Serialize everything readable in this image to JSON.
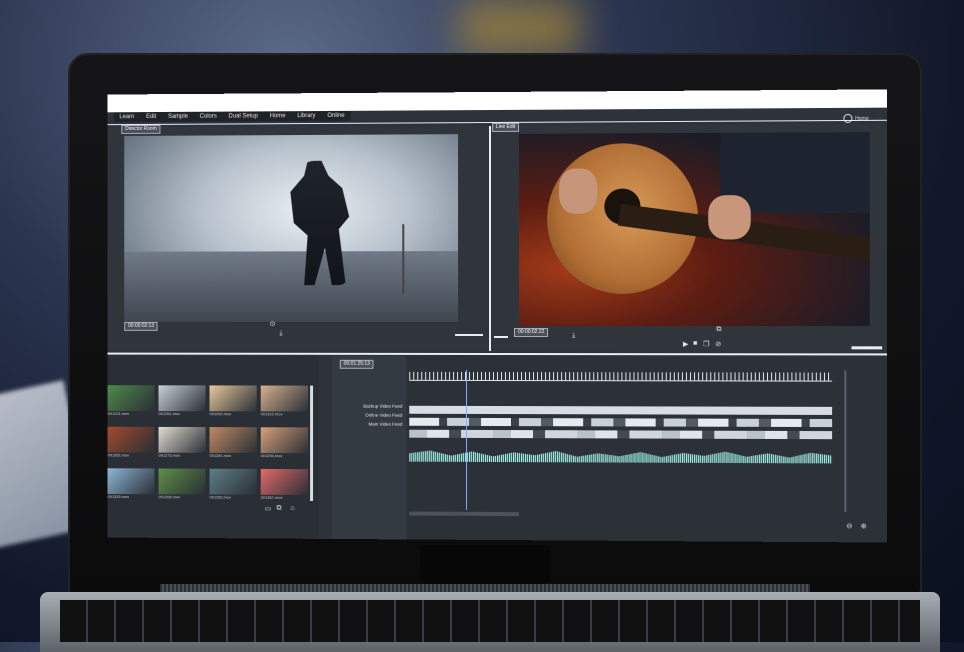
{
  "menu": {
    "items": [
      "Learn",
      "Edit",
      "Sample",
      "Colors",
      "Dual Setup",
      "Home",
      "Library",
      "Online"
    ],
    "user_label": "Home"
  },
  "viewer_left": {
    "tag": "Director Room",
    "timecode": "00:00:02:13"
  },
  "viewer_right": {
    "tag": "Live Edit",
    "timecode": "00:00:02:22"
  },
  "timeline": {
    "timecode": "00:01:25:13",
    "tracks": [
      "Backup Video Feed",
      "Online Video Feed",
      "Main Video Feed"
    ]
  },
  "bin": {
    "thumbs": [
      {
        "caption": "001221.mov",
        "color": "#4f8a4a"
      },
      {
        "caption": "001251.mov",
        "color": "#c9d0d6"
      },
      {
        "caption": "001252.mov",
        "color": "#e8c79a"
      },
      {
        "caption": "001322.mov",
        "color": "#d6b18f"
      },
      {
        "caption": "001262.mov",
        "color": "#a24a2c"
      },
      {
        "caption": "001273.mov",
        "color": "#e2dcd2"
      },
      {
        "caption": "001281.mov",
        "color": "#c08a64"
      },
      {
        "caption": "001250.mov",
        "color": "#d8a07a"
      },
      {
        "caption": "001333.mov",
        "color": "#8fb6d6"
      },
      {
        "caption": "001265.mov",
        "color": "#5d8f45"
      },
      {
        "caption": "001152.mov",
        "color": "#5e7e86"
      },
      {
        "caption": "001367.mov",
        "color": "#e36a6a"
      }
    ]
  },
  "colors": {
    "accent": "#7fb1ff",
    "panel": "#30353c",
    "waveform": "#9fd9d2"
  }
}
